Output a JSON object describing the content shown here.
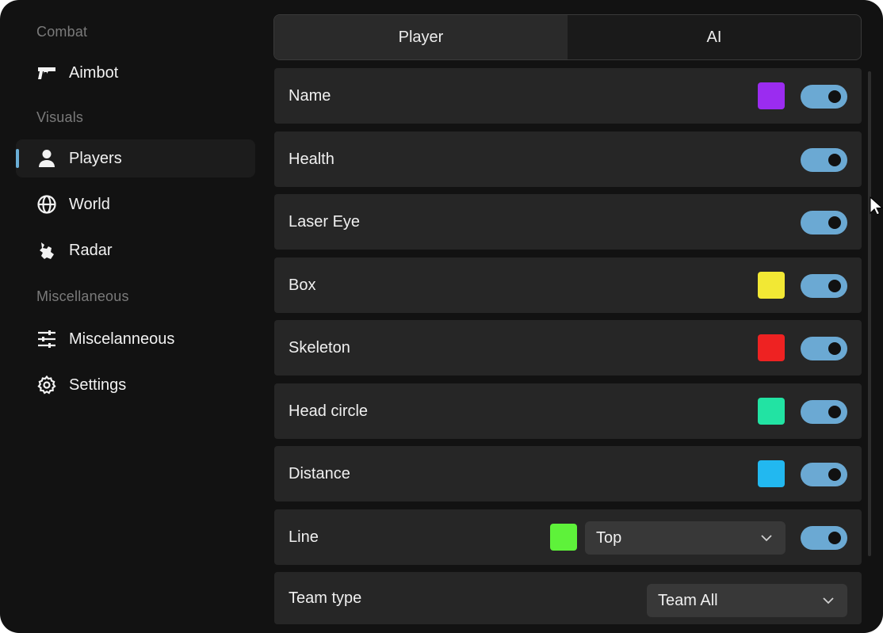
{
  "sidebar": {
    "sections": [
      {
        "label": "Combat"
      },
      {
        "label": "Visuals"
      },
      {
        "label": "Miscellaneous"
      }
    ],
    "items": [
      {
        "label": "Aimbot",
        "icon": "gun-icon"
      },
      {
        "label": "Players",
        "icon": "user-icon",
        "active": true
      },
      {
        "label": "World",
        "icon": "globe-icon"
      },
      {
        "label": "Radar",
        "icon": "radar-icon"
      },
      {
        "label": "Miscelanneous",
        "icon": "sliders-icon"
      },
      {
        "label": "Settings",
        "icon": "gear-icon"
      }
    ]
  },
  "tabs": [
    {
      "label": "Player",
      "active": true
    },
    {
      "label": "AI",
      "active": false
    }
  ],
  "rows": [
    {
      "label": "Name",
      "color": "#9b2cf0",
      "enabled": true
    },
    {
      "label": "Health",
      "enabled": true
    },
    {
      "label": "Laser Eye",
      "enabled": true
    },
    {
      "label": "Box",
      "color": "#f2e834",
      "enabled": true
    },
    {
      "label": "Skeleton",
      "color": "#ee2222",
      "enabled": true
    },
    {
      "label": "Head circle",
      "color": "#22e3a3",
      "enabled": true
    },
    {
      "label": "Distance",
      "color": "#22b8f0",
      "enabled": true
    },
    {
      "label": "Line",
      "color": "#5ef23a",
      "select_value": "Top",
      "enabled": true
    },
    {
      "label": "Team type",
      "select_value": "Team All"
    }
  ],
  "colors": {
    "accent": "#6ba9d3",
    "background": "#121212",
    "row": "#262626"
  }
}
